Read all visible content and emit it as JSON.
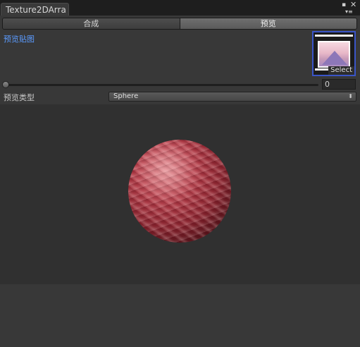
{
  "window": {
    "tab_title": "Texture2DArra",
    "icons": [
      "maximize-icon",
      "close-icon",
      "menu-icon"
    ]
  },
  "toolbar": {
    "tabs": [
      {
        "label": "合成",
        "active": false
      },
      {
        "label": "预览",
        "active": true
      }
    ]
  },
  "texture": {
    "label": "预览贴图",
    "select_label": "Select"
  },
  "slider": {
    "value": "0"
  },
  "preview_type": {
    "label": "预览类型",
    "selected": "Sphere"
  },
  "colors": {
    "accent": "#5b9bff",
    "selection_border": "#3a55c8",
    "sphere": "#a8323c"
  }
}
